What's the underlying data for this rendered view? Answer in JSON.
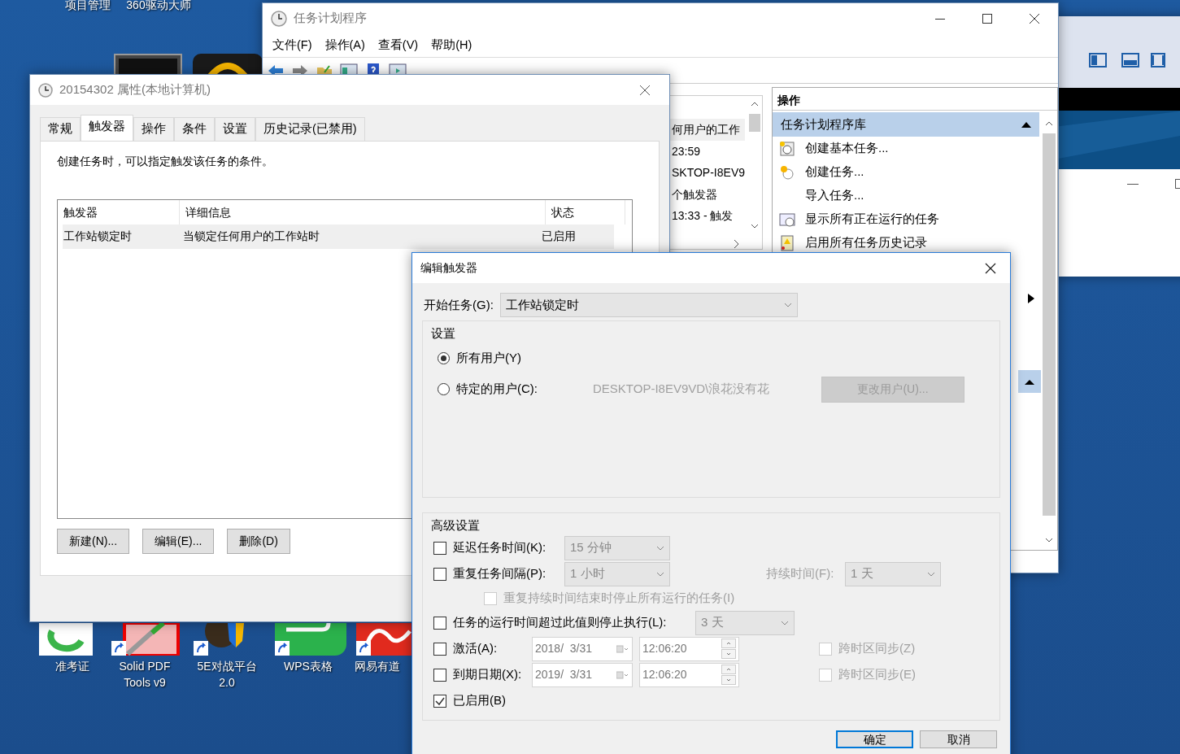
{
  "desktop": {
    "top_labels": [
      "项目管理",
      "360驱动大师"
    ],
    "icons": [
      {
        "label": "准考证",
        "kind": "exam"
      },
      {
        "label": "Solid PDF Tools v9",
        "kind": "pdf"
      },
      {
        "label": "5E对战平台 2.0",
        "kind": "game"
      },
      {
        "label": "WPS表格",
        "kind": "sheet"
      },
      {
        "label": "网易有道",
        "kind": "dict"
      }
    ]
  },
  "task_scheduler": {
    "title": "任务计划程序",
    "menu": [
      "文件(F)",
      "操作(A)",
      "查看(V)",
      "帮助(H)"
    ],
    "middle_lines": [
      "何用户的工作",
      "23:59",
      "SKTOP-I8EV9",
      "个触发器",
      "13:33 - 触发"
    ],
    "actions_header": "操作",
    "actions_section": "任务计划程序库",
    "actions": [
      {
        "label": "创建基本任务...",
        "kind": "basic"
      },
      {
        "label": "创建任务...",
        "kind": "task"
      },
      {
        "label": "导入任务...",
        "kind": "plain"
      },
      {
        "label": "显示所有正在运行的任务",
        "kind": "running"
      },
      {
        "label": "启用所有任务历史记录",
        "kind": "history"
      }
    ]
  },
  "properties": {
    "title": "20154302 属性(本地计算机)",
    "tabs": [
      {
        "label": "常规",
        "selected": false
      },
      {
        "label": "触发器",
        "selected": true
      },
      {
        "label": "操作",
        "selected": false
      },
      {
        "label": "条件",
        "selected": false
      },
      {
        "label": "设置",
        "selected": false
      },
      {
        "label": "历史记录(已禁用)",
        "selected": false
      }
    ],
    "description": "创建任务时，可以指定触发该任务的条件。",
    "columns": [
      "触发器",
      "详细信息",
      "状态"
    ],
    "rows": [
      [
        "工作站锁定时",
        "当锁定任何用户的工作站时",
        "已启用"
      ]
    ],
    "buttons": [
      "新建(N)...",
      "编辑(E)...",
      "删除(D)"
    ]
  },
  "edit_trigger": {
    "title": "编辑触发器",
    "begin_label": "开始任务(G):",
    "begin_value": "工作站锁定时",
    "settings_label": "设置",
    "user_options": [
      {
        "label": "所有用户(Y)",
        "selected": true
      },
      {
        "label": "特定的用户(C):",
        "selected": false
      }
    ],
    "user_name": "DESKTOP-I8EV9VD\\浪花没有花",
    "change_user": {
      "label": "更改用户(U)...",
      "disabled": true
    },
    "advanced_label": "高级设置",
    "delay": {
      "label": "延迟任务时间(K):",
      "checked": false,
      "value": "15 分钟"
    },
    "repeat": {
      "label": "重复任务间隔(P):",
      "checked": false,
      "value": "1 小时",
      "duration_label": "持续时间(F):",
      "duration_value": "1 天"
    },
    "stop_at_end": {
      "label": "重复持续时间结束时停止所有运行的任务(I)",
      "checked": false,
      "disabled": true
    },
    "stop_after": {
      "label": "任务的运行时间超过此值则停止执行(L):",
      "checked": false,
      "value": "3 天"
    },
    "dates": [
      {
        "label": "激活(A):",
        "checked": false,
        "date": "2018/  3/31",
        "time": "12:06:20",
        "sync_label": "跨时区同步(Z)",
        "sync_checked": false
      },
      {
        "label": "到期日期(X):",
        "checked": false,
        "date": "2019/  3/31",
        "time": "12:06:20",
        "sync_label": "跨时区同步(E)",
        "sync_checked": false
      }
    ],
    "enabled": {
      "label": "已启用(B)",
      "checked": true
    },
    "buttons": [
      "确定",
      "取消"
    ]
  }
}
